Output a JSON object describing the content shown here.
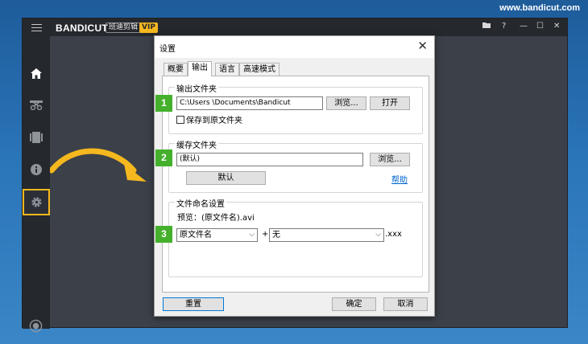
{
  "watermark": "www.bandicut.com",
  "app": {
    "brand_bandi": "BANDI",
    "brand_cut": "CUT",
    "brand_cn": "班迪剪辑",
    "vip": "VIP",
    "window_controls": [
      "▬",
      "?",
      "—",
      "☐",
      "✕"
    ]
  },
  "sidebar": {
    "items": [
      "home-icon",
      "cut-icon",
      "film-icon",
      "info-icon",
      "gear-icon"
    ],
    "record": "record-icon"
  },
  "dialog": {
    "title": "设置",
    "close": "✕",
    "tabs": [
      "概要",
      "输出",
      "语言",
      "高速模式"
    ],
    "active_tab": "输出",
    "output_folder": {
      "label": "输出文件夹",
      "path": "C:\\Users \\Documents\\Bandicut",
      "browse": "浏览...",
      "open": "打开",
      "save_to_original": "保存到原文件夹"
    },
    "cache_folder": {
      "label": "缓存文件夹",
      "value": "(默认)",
      "browse": "浏览...",
      "default": "默认",
      "help": "帮助"
    },
    "naming": {
      "label": "文件命名设置",
      "preview_label": "预览：",
      "preview_value": "(原文件名).avi",
      "select1": "原文件名",
      "plus": "+",
      "select2": "无",
      "suffix": ".xxx"
    },
    "buttons": {
      "reset": "重置",
      "ok": "确定",
      "cancel": "取消"
    }
  },
  "badges": [
    "1",
    "2",
    "3"
  ],
  "colors": {
    "highlight": "#f5b81f",
    "badge": "#44b02c",
    "link": "#0066cc"
  }
}
